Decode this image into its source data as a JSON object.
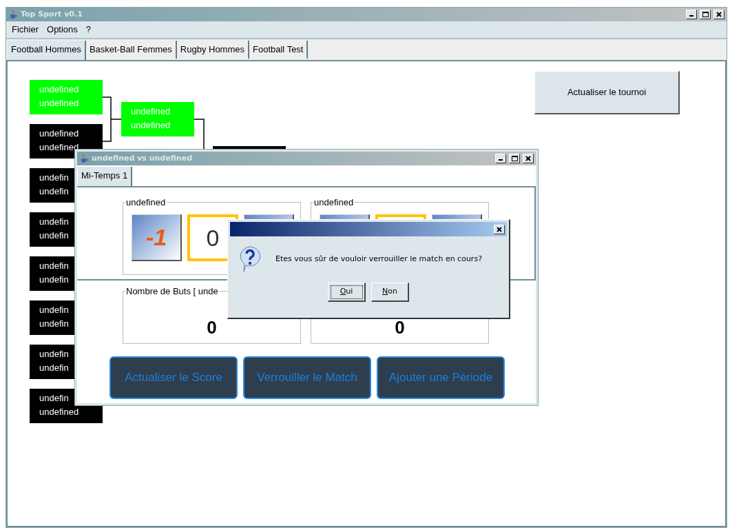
{
  "window": {
    "title": "Top Sport v0.1"
  },
  "menu": [
    "Fichier",
    "Options",
    "?"
  ],
  "tabs": [
    {
      "label": "Football Hommes",
      "selected": true
    },
    {
      "label": "Basket-Ball Femmes",
      "selected": false
    },
    {
      "label": "Rugby Hommes",
      "selected": false
    },
    {
      "label": "Football Test",
      "selected": false
    }
  ],
  "refresh_button": "Actualiser le tournoi",
  "bracket": {
    "rounds": [
      [
        {
          "color": "#00ff00",
          "lines": [
            "undefined",
            "undefined"
          ]
        },
        {
          "color": "#000000",
          "lines": [
            "undefined",
            "undefined"
          ]
        },
        {
          "color": "#000000",
          "lines": [
            "undefin",
            "undefin"
          ]
        },
        {
          "color": "#000000",
          "lines": [
            "undefin",
            "undefin"
          ]
        },
        {
          "color": "#000000",
          "lines": [
            "undefin",
            "undefin"
          ]
        },
        {
          "color": "#000000",
          "lines": [
            "undefin",
            "undefin"
          ]
        },
        {
          "color": "#000000",
          "lines": [
            "undefin",
            "undefin"
          ]
        },
        {
          "color": "#000000",
          "lines": [
            "undefin",
            "undefined"
          ]
        }
      ],
      [
        {
          "color": "#00ff00",
          "lines": [
            "undefined",
            "undefined"
          ]
        }
      ],
      [
        {
          "color": "#000000"
        }
      ]
    ]
  },
  "match_window": {
    "title": "undefined vs undefined",
    "tabs": [
      {
        "label": "Mi-Temps 1",
        "selected": true
      }
    ],
    "teams": [
      {
        "legend": "undefined",
        "decrement": "-1",
        "score": "0"
      },
      {
        "legend": "undefined"
      }
    ],
    "goals": [
      {
        "legend": "Nombre de Buts [ unde",
        "value": "0"
      },
      {
        "value": "0"
      }
    ],
    "actions": [
      "Actualiser le Score",
      "Verrouiller le Match",
      "Ajouter une Période"
    ]
  },
  "dialog": {
    "message": "Etes vous sûr de vouloir verrouiller le match en cours?",
    "buttons": [
      {
        "label": "Oui",
        "focused": true
      },
      {
        "label": "Non",
        "focused": false
      }
    ]
  }
}
